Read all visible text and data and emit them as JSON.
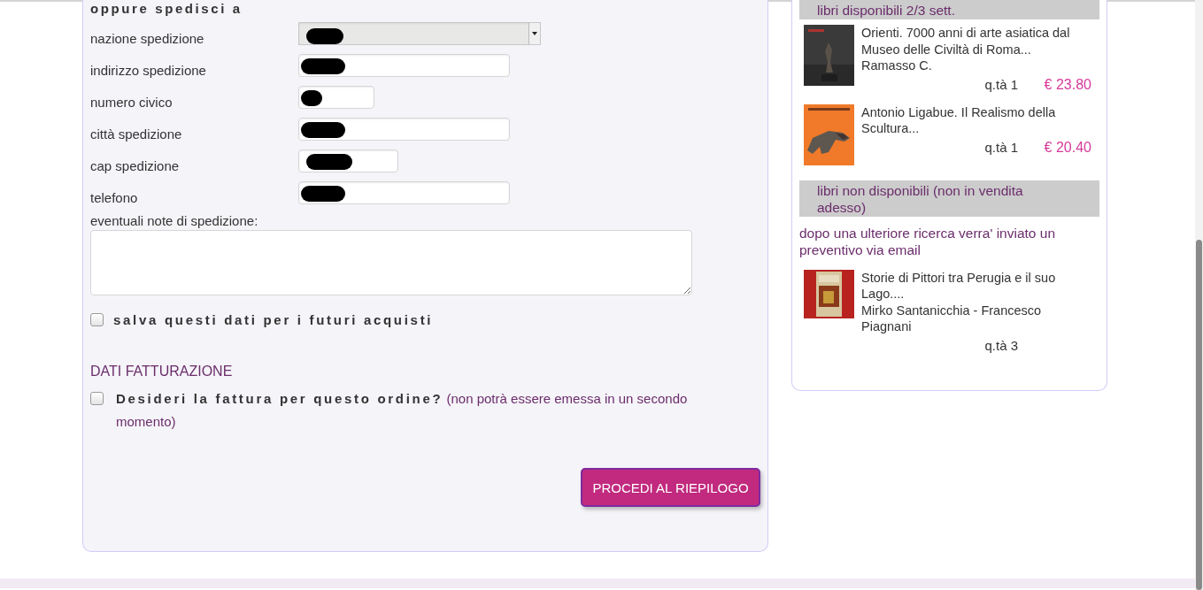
{
  "shipping_form": {
    "heading": "oppure spedisci a",
    "fields": [
      {
        "label": "nazione spedizione",
        "kind": "select",
        "redacted": true
      },
      {
        "label": "indirizzo spedizione",
        "kind": "text",
        "redacted": true
      },
      {
        "label": "numero civico",
        "kind": "short",
        "redacted": true
      },
      {
        "label": "città spedizione",
        "kind": "text",
        "redacted": true
      },
      {
        "label": "cap spedizione",
        "kind": "medium",
        "redacted": true
      },
      {
        "label": "telefono",
        "kind": "text",
        "redacted": true
      }
    ],
    "notes_label": "eventuali note di spedizione:",
    "save_option": {
      "label": "salva questi dati per i futuri acquisti",
      "checked": false
    }
  },
  "billing": {
    "heading": "DATI FATTURAZIONE",
    "invoice_option": {
      "text": "**Desideri la fattura per questo ordine?** (non potrà essere emessa in un secondo momento)",
      "checked": false
    }
  },
  "submit_button": "PROCEDI AL RIEPILOGO",
  "cart": {
    "sections": [
      {
        "heading": "libri disponibili 2/3 sett.",
        "items": [
          {
            "title": "Orienti. 7000 anni di arte asiatica dal Museo delle Civiltà di Roma...",
            "author": "Ramasso C.",
            "quantity": "q.tà 1",
            "price": "€ 23.80"
          },
          {
            "title": "Antonio Ligabue. Il Realismo della Scultura...",
            "quantity": "q.tà 1",
            "price": "€ 20.40"
          }
        ]
      },
      {
        "heading": "libri non disponibili (non in vendita adesso)",
        "note": "dopo una ulteriore ricerca verra' inviato un preventivo via email",
        "items": [
          {
            "title": "Storie di Pittori tra Perugia e il suo Lago....",
            "author": "Mirko Santanicchia - Francesco Piagnani",
            "quantity": "q.tà 3"
          }
        ]
      }
    ]
  }
}
